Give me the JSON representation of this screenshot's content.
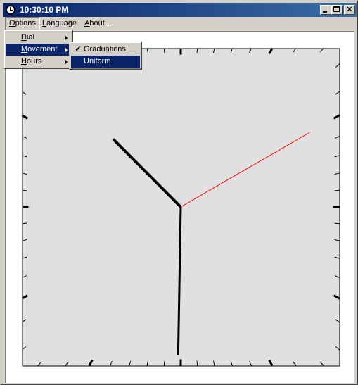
{
  "window": {
    "title": "10:30:10 PM"
  },
  "menubar": {
    "items": [
      {
        "label_ul": "O",
        "label_rest": "ptions"
      },
      {
        "label_ul": "L",
        "label_rest": "anguage"
      },
      {
        "label_ul": "A",
        "label_rest": "bout..."
      }
    ]
  },
  "options_menu": {
    "items": [
      {
        "label_ul": "D",
        "label_rest": "ial"
      },
      {
        "label_ul": "M",
        "label_rest": "ovement"
      },
      {
        "label_ul": "H",
        "label_rest": "ours"
      }
    ]
  },
  "movement_submenu": {
    "items": [
      {
        "label": "Graduations",
        "checked": true
      },
      {
        "label": "Uniform",
        "checked": false
      }
    ]
  },
  "clock": {
    "time": {
      "hours": 22,
      "minutes": 30,
      "seconds": 10
    },
    "colors": {
      "face": "#e0e0e0",
      "hands": "#000000",
      "second_hand": "#ff0000",
      "background": "#ffffff"
    }
  },
  "icons": [
    "clock-app-icon",
    "minimize-icon",
    "maximize-icon",
    "close-icon",
    "submenu-arrow-icon",
    "check-icon"
  ]
}
